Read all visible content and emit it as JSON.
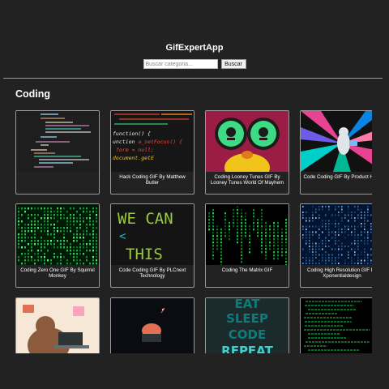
{
  "app": {
    "title": "GifExpertApp"
  },
  "search": {
    "placeholder": "Buscar categoria...",
    "value": "",
    "button_label": "Buscar"
  },
  "category": {
    "title": "Coding"
  },
  "gifs": [
    {
      "title": "",
      "icon": "code-editor-thumbnail"
    },
    {
      "title": "Hack Coding GIF By Matthew Butler",
      "icon": "code-lines-thumbnail"
    },
    {
      "title": "Coding Looney Tunes GIF By Looney Tunes World Of Mayhem",
      "icon": "cartoon-character-thumbnail"
    },
    {
      "title": "Code Coding GIF By Product Hunt",
      "icon": "cat-space-thumbnail"
    },
    {
      "title": "Coding Zero One GIF By Squirrel Monkey",
      "icon": "binary-rain-thumbnail"
    },
    {
      "title": "Code Coding GIF By PLCnext Technology",
      "icon": "we-can-text-thumbnail"
    },
    {
      "title": "Coding The Matrix GIF",
      "icon": "matrix-thumbnail"
    },
    {
      "title": "Coding High Resolution GIF By Xponentialdesign",
      "icon": "blue-binary-thumbnail"
    },
    {
      "title": "",
      "icon": "bear-laptop-thumbnail"
    },
    {
      "title": "",
      "icon": "dark-scene-thumbnail"
    },
    {
      "title": "",
      "icon": "eat-sleep-code-thumbnail"
    },
    {
      "title": "",
      "icon": "terminal-thumbnail"
    }
  ],
  "thumb_text": {
    "we_can": [
      "WE CAN",
      "<",
      "THIS"
    ],
    "eat_sleep": [
      "EAT",
      "SLEEP",
      "CODE",
      "REPEAT"
    ]
  },
  "colors": {
    "background": "#222222",
    "border": "#9a9a9a",
    "matrix_green": "#1ad14a",
    "lime": "#9acb3a"
  }
}
